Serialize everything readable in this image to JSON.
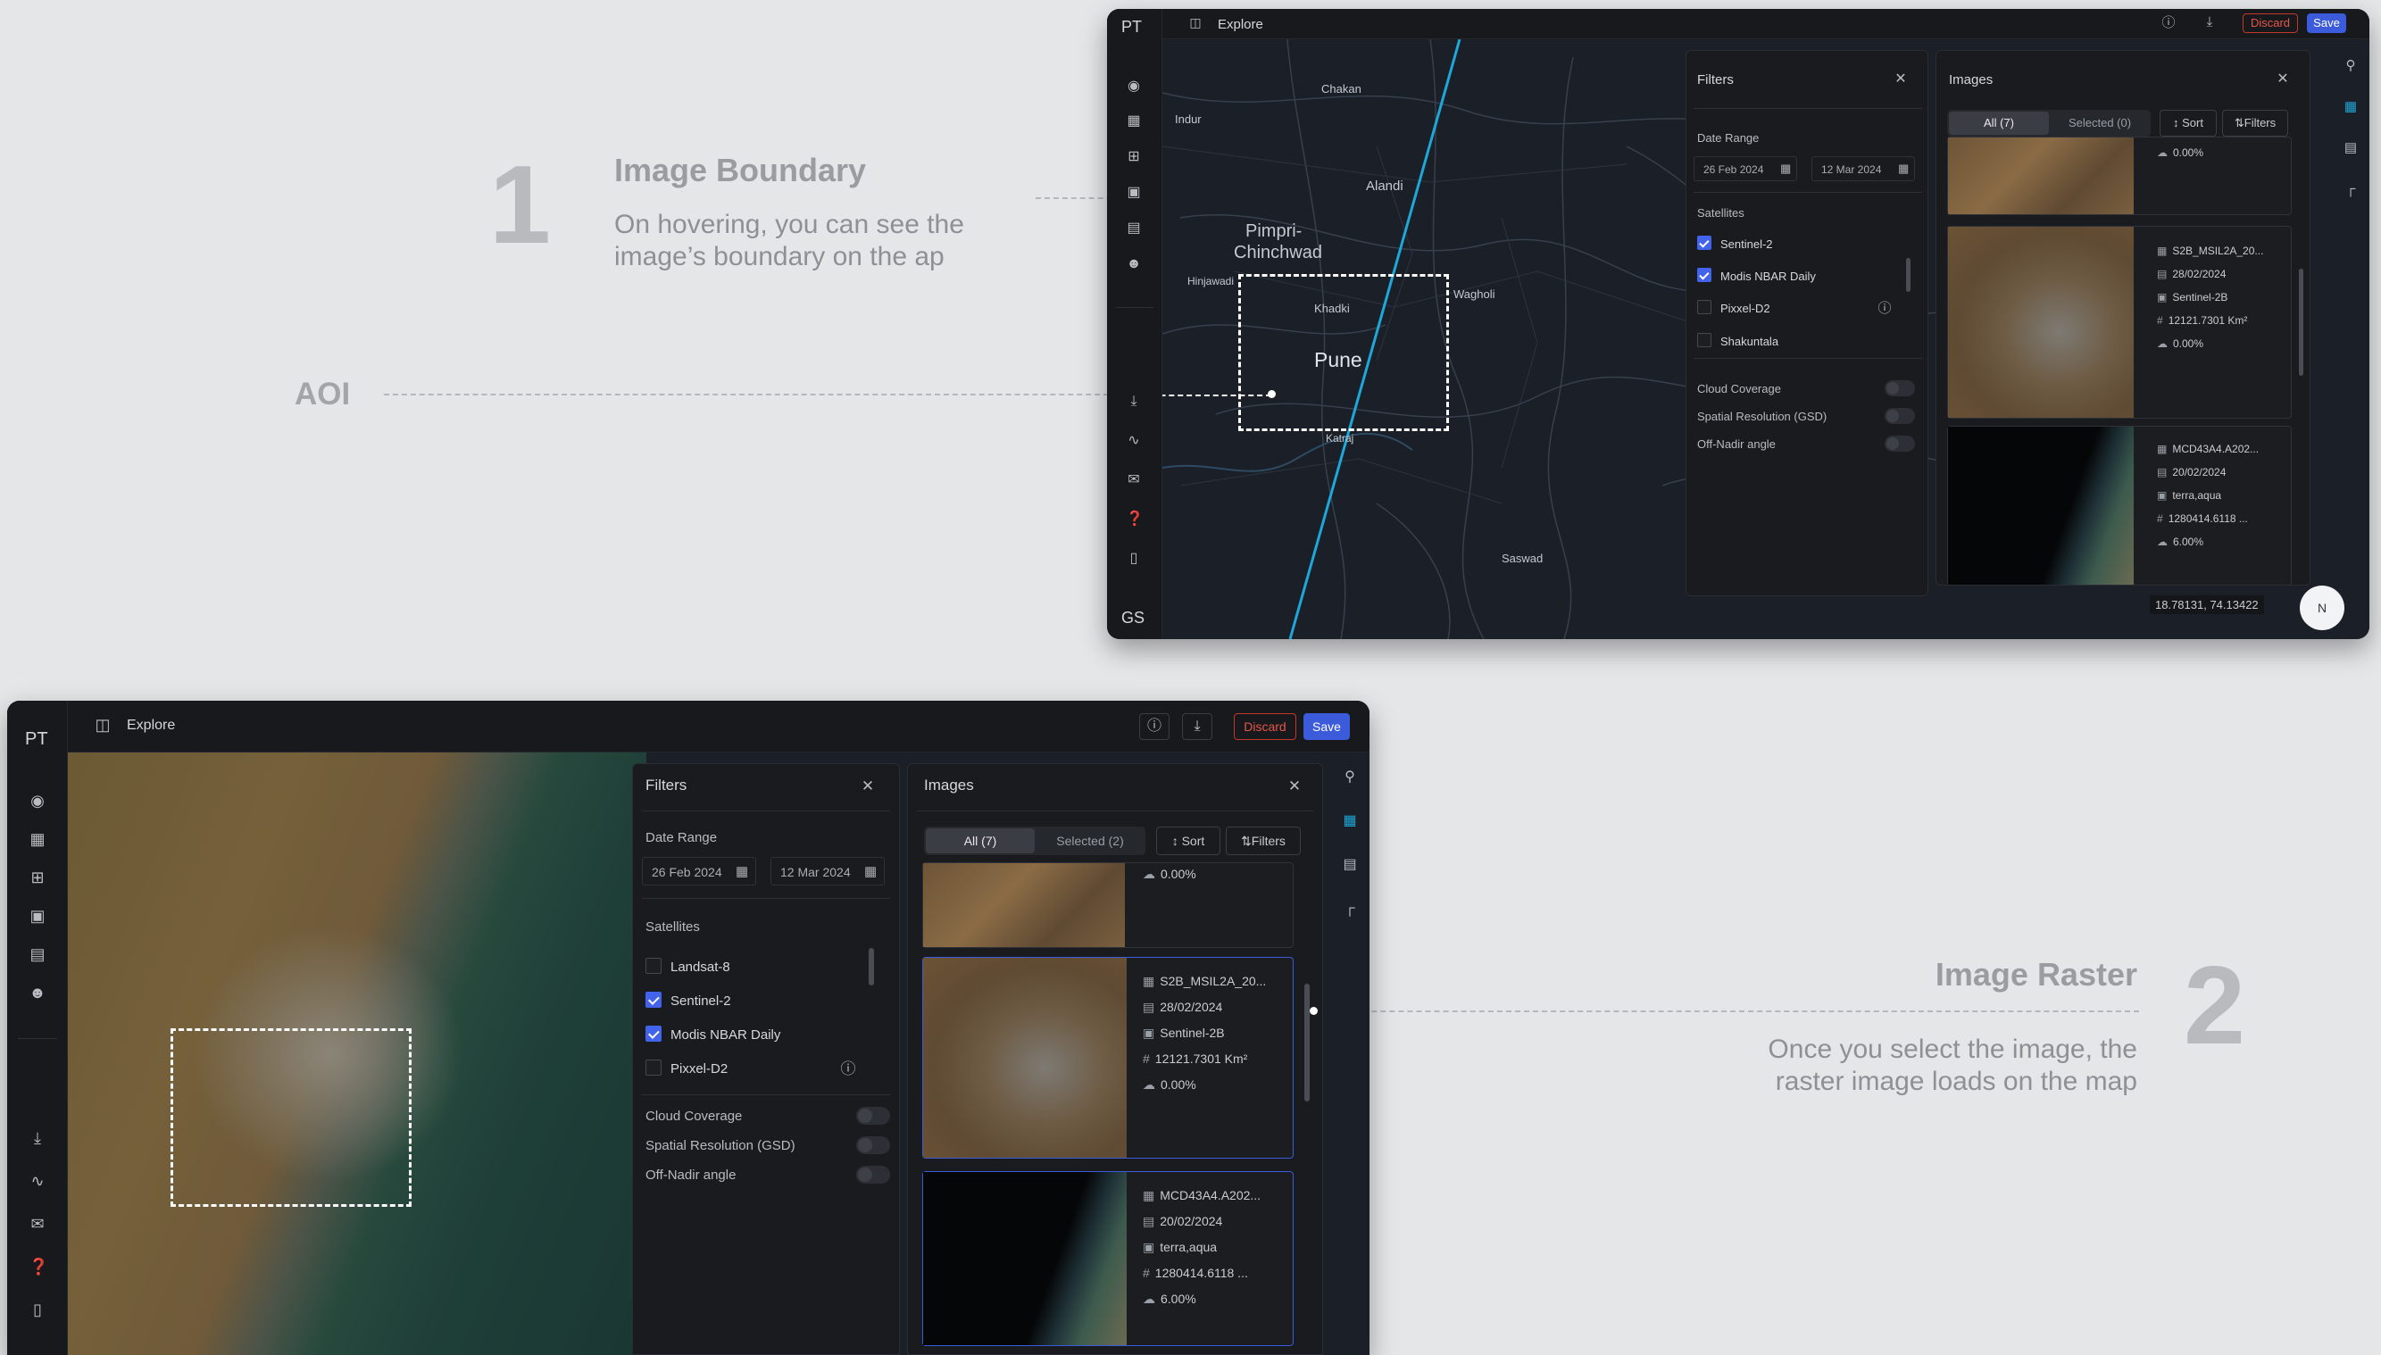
{
  "annotations": {
    "one": {
      "number": "1",
      "title": "Image Boundary",
      "desc_line1": "On hovering, you can see the",
      "desc_line2": "image’s boundary on the ap"
    },
    "aoi": "AOI",
    "two": {
      "number": "2",
      "title": "Image Raster",
      "desc_line1": "Once you select the image, the",
      "desc_line2": "raster image loads on the map"
    }
  },
  "app": {
    "avatar": "PT",
    "footer_avatar": "GS",
    "title": "Explore",
    "discard_label": "Discard",
    "save_label": "Save",
    "coords": "18.78131, 74.13422",
    "compass": "N"
  },
  "filters": {
    "title": "Filters",
    "date_range_label": "Date Range",
    "date_from": "26 Feb 2024",
    "date_to": "12 Mar 2024",
    "satellites_label": "Satellites",
    "satellites_top": [
      {
        "name": "Sentinel-2",
        "checked": true
      },
      {
        "name": "Modis NBAR Daily",
        "checked": true
      },
      {
        "name": "Pixxel-D2",
        "checked": false
      },
      {
        "name": "Shakuntala",
        "checked": false
      }
    ],
    "satellites_bottom": [
      {
        "name": "Landsat-8",
        "checked": false
      },
      {
        "name": "Sentinel-2",
        "checked": true
      },
      {
        "name": "Modis NBAR Daily",
        "checked": true
      },
      {
        "name": "Pixxel-D2",
        "checked": false
      }
    ],
    "cloud_coverage": "Cloud Coverage",
    "spatial_resolution": "Spatial Resolution (GSD)",
    "off_nadir": "Off-Nadir angle"
  },
  "images": {
    "title": "Images",
    "all_tab": "All (7)",
    "selected_tab_top": "Selected (0)",
    "selected_tab_bottom": "Selected (2)",
    "sort_label": "Sort",
    "filters_label": "Filters",
    "first_cloud": "0.00%",
    "items": [
      {
        "id": "S2B_MSIL2A_20...",
        "date": "28/02/2024",
        "sensor": "Sentinel-2B",
        "area": "12121.7301 Km²",
        "cloud": "0.00%"
      },
      {
        "id": "MCD43A4.A202...",
        "date": "20/02/2024",
        "sensor": "terra,aqua",
        "area": "1280414.6118 ...",
        "cloud": "6.00%"
      }
    ]
  },
  "map_labels": {
    "chakan": "Chakan",
    "indur": "Indur",
    "alandi": "Alandi",
    "pimpri": "Pimpri-",
    "chinchwad": "Chinchwad",
    "hinjawadi": "Hinjawadi",
    "khadki": "Khadki",
    "wagholi": "Wagholi",
    "pune": "Pune",
    "katraj": "Katraj",
    "saswad": "Saswad"
  },
  "colors": {
    "accent": "#3b5bdb",
    "discard": "#e5574a",
    "track": "#1ea7d8"
  }
}
